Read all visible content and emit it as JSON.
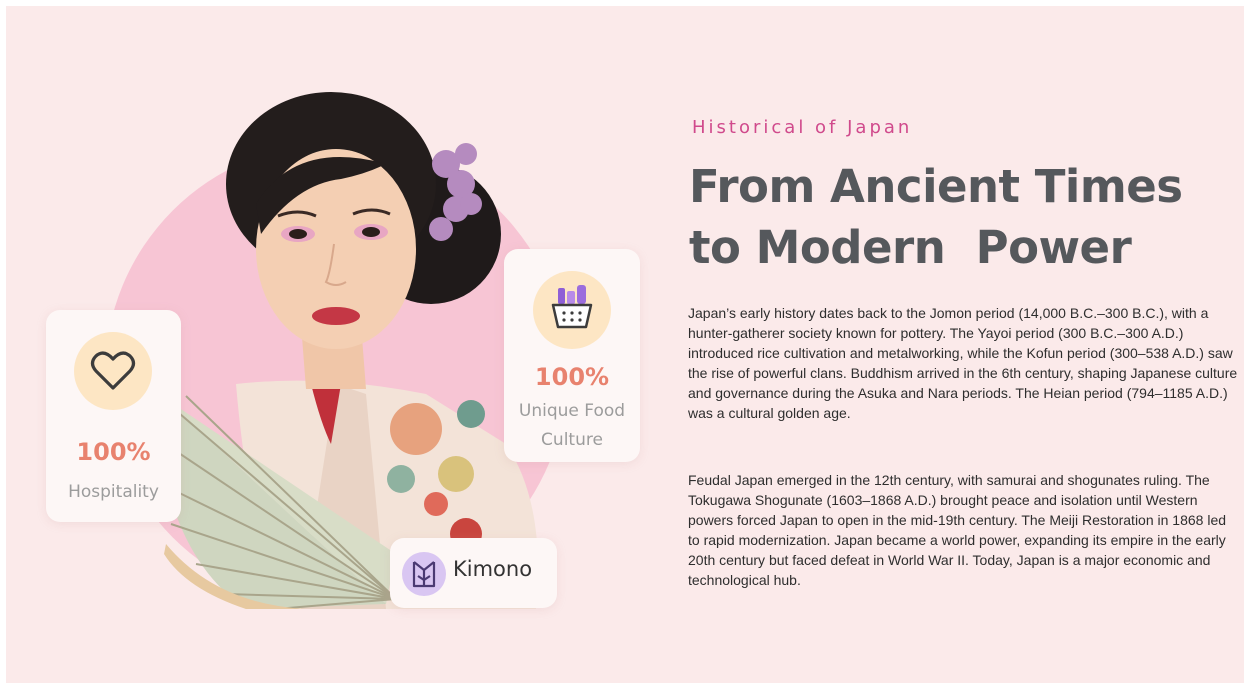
{
  "section": {
    "eyebrow": "Historical of Japan",
    "headline_line1": "From Ancient Times",
    "headline_line2": "to Modern  Power"
  },
  "paragraphs": [
    "Japan’s early history dates back to the Jomon period (14,000 B.C.–300 B.C.), with a hunter-gatherer society known for pottery. The Yayoi period (300 B.C.–300 A.D.) introduced rice cultivation and metalworking, while the Kofun period (300–538 A.D.) saw the rise of powerful clans. Buddhism arrived in the 6th century, shaping Japanese culture and governance during the Asuka and Nara periods. The Heian period (794–1185 A.D.) was a cultural golden age.",
    "Feudal Japan emerged in the 12th century, with samurai and shogunates ruling. The Tokugawa Shogunate (1603–1868 A.D.) brought peace and isolation until Western powers forced Japan to open in the mid-19th century. The Meiji Restoration in 1868 led to rapid modernization. Japan became a world power, expanding its empire in the early 20th century but faced defeat in World War II. Today, Japan is a major economic and technological hub."
  ],
  "cards": {
    "hospitality": {
      "icon": "heart-icon",
      "percent": "100%",
      "label": "Hospitality"
    },
    "food": {
      "icon": "food-basket-icon",
      "percent": "100%",
      "label": "Unique Food Culture"
    },
    "kimono": {
      "icon": "kimono-icon",
      "label": "Kimono"
    }
  },
  "colors": {
    "background": "#fbeaea",
    "circle": "#f7c5d4",
    "accent_pink": "#d04a8c",
    "percent_orange": "#e8826e",
    "headline_gray": "#55585c"
  }
}
